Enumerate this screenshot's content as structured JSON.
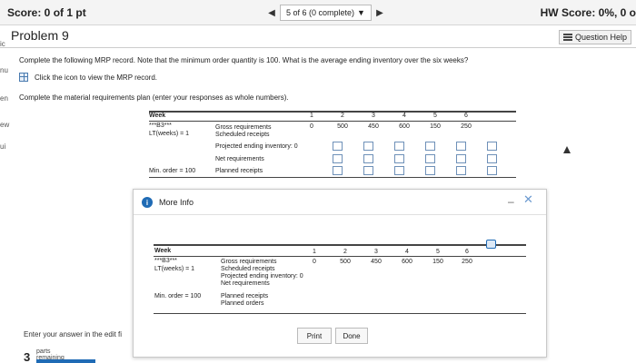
{
  "header": {
    "score": "Score: 0 of 1 pt",
    "nav_position": "5 of 6 (0 complete)",
    "hw_score": "HW Score: 0%, 0 o"
  },
  "left_edge": [
    "ic",
    "nu",
    "en",
    "ew",
    "ui"
  ],
  "problem": {
    "title": "Problem 9",
    "question_help": "Question Help",
    "instruction": "Complete the following MRP record. Note that the minimum order quantity is 100. What is the average ending inventory over the six weeks?",
    "icon_hint": "Click the icon to view the MRP record.",
    "complete_prompt": "Complete the material requirements plan (enter your responses as whole numbers)."
  },
  "mrp": {
    "week_label": "Week",
    "item": "***B3***",
    "lead_time": "LT(weeks) = 1",
    "min_order": "Min. order = 100",
    "weeks": [
      "1",
      "2",
      "3",
      "4",
      "5",
      "6"
    ],
    "gross": [
      "0",
      "500",
      "450",
      "600",
      "150",
      "250"
    ],
    "row_labels": [
      "Gross requirements",
      "Scheduled receipts",
      "Projected ending inventory: 0",
      "Net requirements",
      "Planned receipts"
    ]
  },
  "modal": {
    "title": "More Info",
    "week_label": "Week",
    "item": "***B3***",
    "lead_time": "LT(weeks) = 1",
    "min_order": "Min. order = 100",
    "weeks": [
      "1",
      "2",
      "3",
      "4",
      "5",
      "6"
    ],
    "gross": [
      "0",
      "500",
      "450",
      "600",
      "150",
      "250"
    ],
    "row_labels": [
      "Gross requirements",
      "Scheduled receipts",
      "Projected ending inventory: 0",
      "Net requirements",
      "Planned receipts",
      "Planned orders"
    ],
    "print_label": "Print",
    "done_label": "Done"
  },
  "footer": {
    "answer_hint": "Enter your answer in the edit fi",
    "parts_count": "3",
    "parts_label": "parts",
    "parts_sub": "remaining"
  }
}
